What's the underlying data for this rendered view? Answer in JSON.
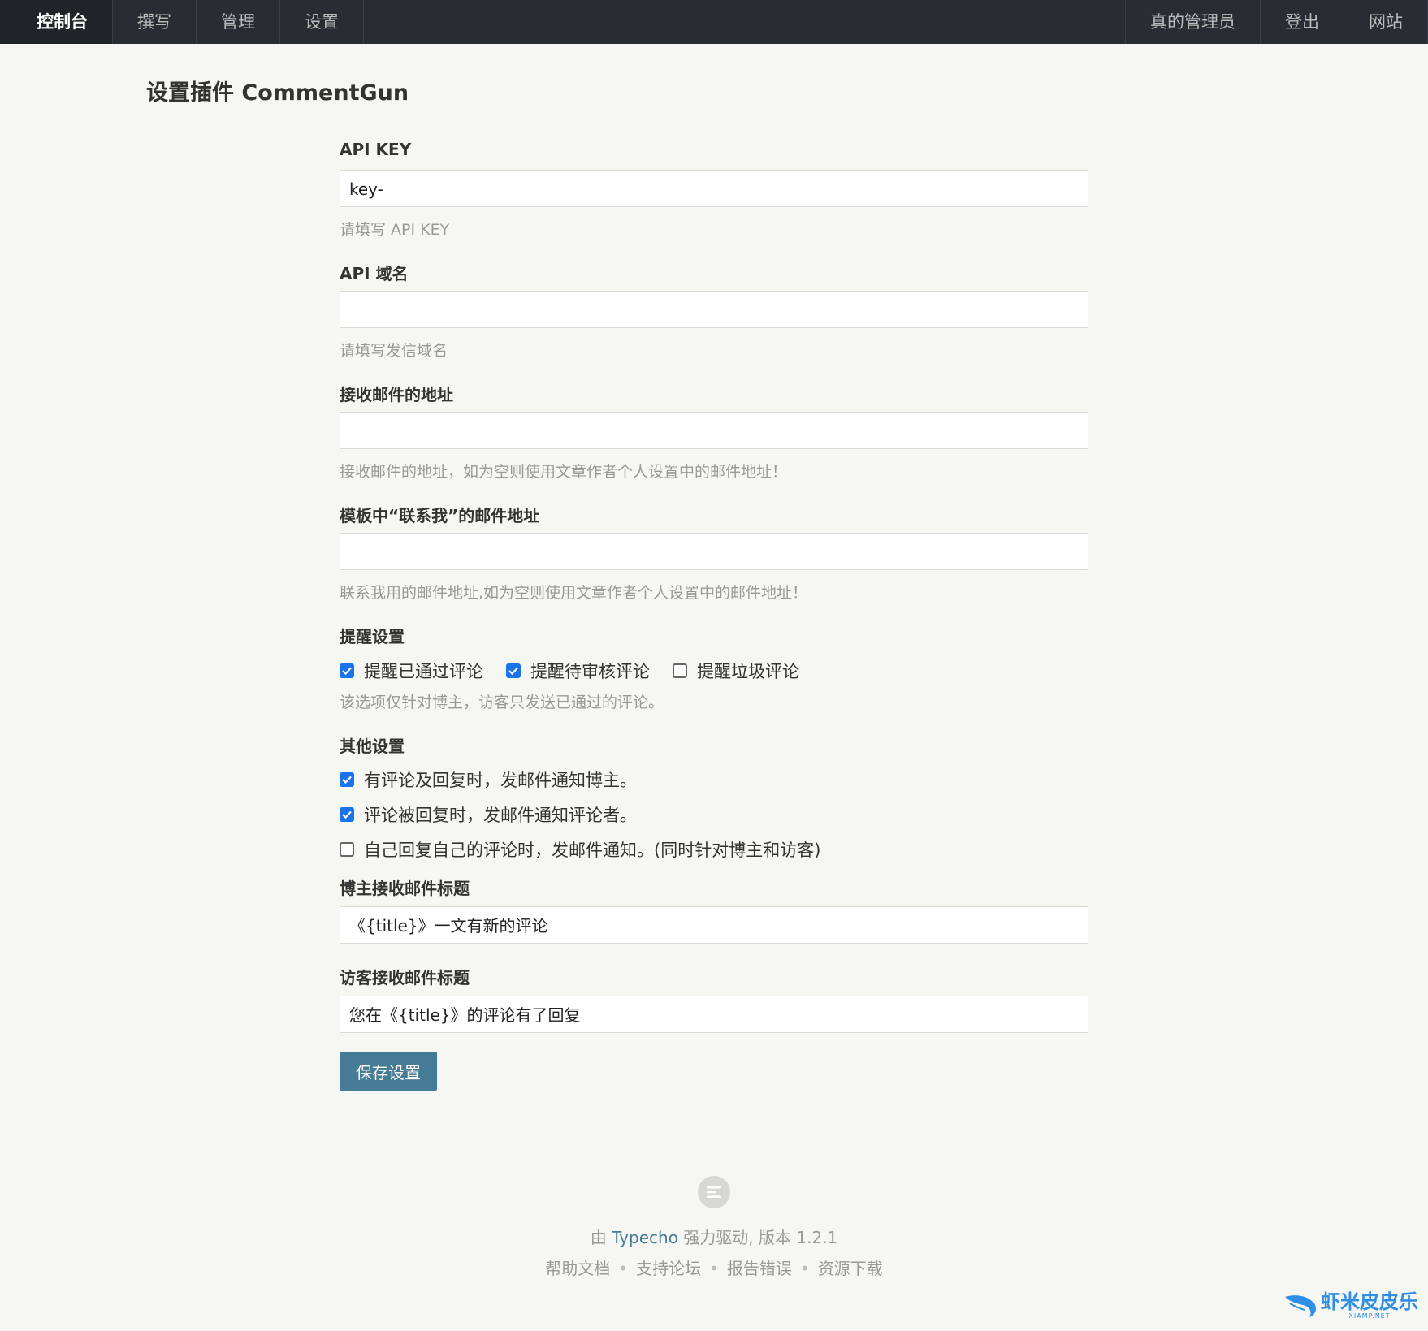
{
  "nav": {
    "left": [
      "控制台",
      "撰写",
      "管理",
      "设置"
    ],
    "right": [
      "真的管理员",
      "登出",
      "网站"
    ]
  },
  "page_title": "设置插件 CommentGun",
  "fields": {
    "api_key": {
      "label": "API KEY",
      "value": "key-",
      "desc": "请填写 API KEY"
    },
    "api_domain": {
      "label": "API 域名",
      "value": "",
      "desc": "请填写发信域名"
    },
    "receive_addr": {
      "label": "接收邮件的地址",
      "value": "",
      "desc": "接收邮件的地址，如为空则使用文章作者个人设置中的邮件地址！"
    },
    "contact_addr": {
      "label": "模板中“联系我”的邮件地址",
      "value": "",
      "desc": "联系我用的邮件地址,如为空则使用文章作者个人设置中的邮件地址！"
    }
  },
  "remind": {
    "label": "提醒设置",
    "options": [
      {
        "label": "提醒已通过评论",
        "checked": true
      },
      {
        "label": "提醒待审核评论",
        "checked": true
      },
      {
        "label": "提醒垃圾评论",
        "checked": false
      }
    ],
    "desc": "该选项仅针对博主，访客只发送已通过的评论。"
  },
  "other": {
    "label": "其他设置",
    "options": [
      {
        "label": "有评论及回复时，发邮件通知博主。",
        "checked": true
      },
      {
        "label": "评论被回复时，发邮件通知评论者。",
        "checked": true
      },
      {
        "label": "自己回复自己的评论时，发邮件通知。(同时针对博主和访客)",
        "checked": false
      }
    ]
  },
  "owner_subject": {
    "label": "博主接收邮件标题",
    "value": "《{title}》一文有新的评论"
  },
  "guest_subject": {
    "label": "访客接收邮件标题",
    "value": "您在《{title}》的评论有了回复"
  },
  "save_label": "保存设置",
  "footer": {
    "powered_prefix": "由 ",
    "powered_link": "Typecho",
    "powered_suffix": " 强力驱动, 版本 1.2.1",
    "links": [
      "帮助文档",
      "支持论坛",
      "报告错误",
      "资源下载"
    ],
    "separator": "•"
  },
  "watermark": {
    "title": "虾米皮皮乐",
    "sub": "XIAMP.NET"
  },
  "colors": {
    "nav_bg": "#292d33",
    "accent": "#467b96",
    "checkbox": "#1a73e8"
  }
}
